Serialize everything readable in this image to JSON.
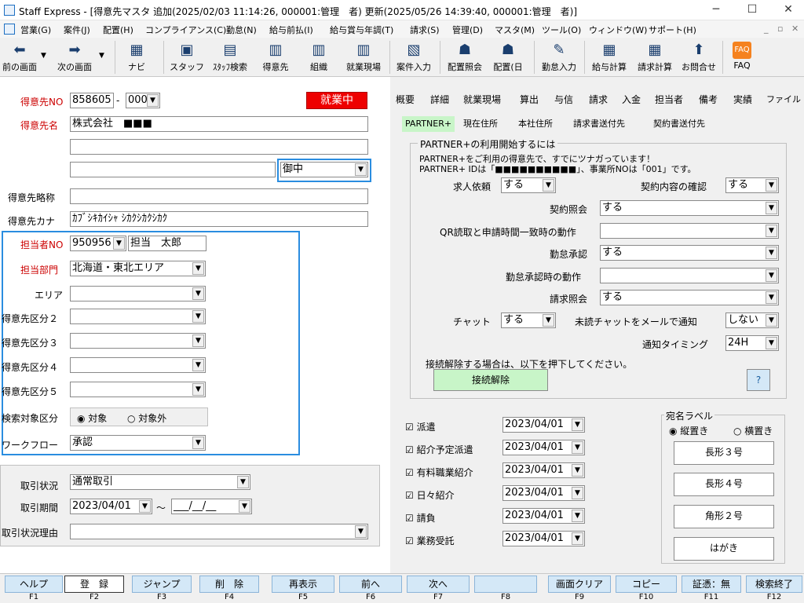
{
  "window": {
    "title": "Staff Express - [得意先マスタ 追加(2025/02/03 11:14:26, 000001:管理　者) 更新(2025/05/26 14:39:40, 000001:管理　者)]"
  },
  "menu": [
    "営業(G)",
    "案件(J)",
    "配置(H)",
    "コンプライアンス(C)",
    "勤怠(N)",
    "給与前払(I)",
    "給与賞与年調(T)",
    "請求(S)",
    "管理(D)",
    "マスタ(M)",
    "ツール(O)",
    "ウィンドウ(W)",
    "サポート(H)"
  ],
  "toolbar": [
    "前の画面",
    "次の画面",
    "ナビ",
    "スタッフ",
    "ｽﾀｯﾌ検索",
    "得意先",
    "組織",
    "就業現場",
    "案件入力",
    "配置照会",
    "配置(日",
    "勤怠入力",
    "給与計算",
    "請求計算",
    "お問合せ",
    "FAQ"
  ],
  "left": {
    "customer_no_label": "得意先NO",
    "customer_no": "858605",
    "customer_no_sep": "-",
    "customer_no_sub": "000",
    "status_badge": "就業中",
    "name_label": "得意先名",
    "name_value": "株式会社　■■■",
    "honorific": "御中",
    "short_label": "得意先略称",
    "kana_label": "得意先カナ",
    "kana_value": "ｶﾌﾞｼｷｶｲｼｬ ｼｶｸｼｶｸｼｶｸ",
    "staff_no_label": "担当者NO",
    "staff_no": "950956",
    "staff_name": "担当　太郎",
    "dept_label": "担当部門",
    "dept_value": "北海道・東北エリア",
    "area_label": "エリア",
    "cat2": "得意先区分２",
    "cat3": "得意先区分３",
    "cat4": "得意先区分４",
    "cat5": "得意先区分５",
    "search_label": "検索対象区分",
    "search_on": "対象",
    "search_off": "対象外",
    "workflow_label": "ワークフロー",
    "workflow_value": "承認",
    "trade_status_label": "取引状況",
    "trade_status_value": "通常取引",
    "trade_period_label": "取引期間",
    "trade_from": "2023/04/01",
    "trade_tilde": "～",
    "trade_to": "___/__/__",
    "trade_reason_label": "取引状況理由"
  },
  "tabs": [
    "概要",
    "詳細",
    "就業現場",
    "算出",
    "与信",
    "請求",
    "入金",
    "担当者",
    "備考",
    "実績",
    "ファイル"
  ],
  "subtabs": [
    "PARTNER+",
    "現在住所",
    "本社住所",
    "請求書送付先",
    "契約書送付先"
  ],
  "partner": {
    "group_title": "PARTNER+の利用開始するには",
    "line1": "PARTNER+をご利用の得意先で、すでにツナガっています！",
    "line2": "PARTNER+ IDは「■■■■■■■■■■」、事業所NOは「001」です。",
    "req_label": "求人依頼",
    "req_value": "する",
    "confirm_label": "契約内容の確認",
    "confirm_value": "する",
    "contract_label": "契約照会",
    "contract_value": "する",
    "qr_label": "QR読取と申請時間一致時の動作",
    "att_label": "勤怠承認",
    "att_value": "する",
    "att_act_label": "勤怠承認時の動作",
    "bill_label": "請求照会",
    "bill_value": "する",
    "chat_label": "チャット",
    "chat_value": "する",
    "mail_label": "未読チャットをメールで通知",
    "mail_value": "しない",
    "timing_label": "通知タイミング",
    "timing_value": "24H",
    "disconnect_note": "接続解除する場合は、以下を押下してください。",
    "disconnect_btn": "接続解除",
    "help_btn": "?"
  },
  "contracts": [
    {
      "label": "派遣",
      "date": "2023/04/01"
    },
    {
      "label": "紹介予定派遣",
      "date": "2023/04/01"
    },
    {
      "label": "有料職業紹介",
      "date": "2023/04/01"
    },
    {
      "label": "日々紹介",
      "date": "2023/04/01"
    },
    {
      "label": "請負",
      "date": "2023/04/01"
    },
    {
      "label": "業務受託",
      "date": "2023/04/01"
    }
  ],
  "address_label": {
    "title": "宛名ラベル",
    "vertical": "縦置き",
    "horizontal": "横置き",
    "b1": "長形３号",
    "b2": "長形４号",
    "b3": "角形２号",
    "b4": "はがき"
  },
  "fkeys": [
    {
      "label": "ヘルプ",
      "num": "F1"
    },
    {
      "label": "登　録",
      "num": "F2"
    },
    {
      "label": "ジャンプ",
      "num": "F3"
    },
    {
      "label": "削　除",
      "num": "F4"
    },
    {
      "label": "再表示",
      "num": "F5"
    },
    {
      "label": "前へ",
      "num": "F6"
    },
    {
      "label": "次へ",
      "num": "F7"
    },
    {
      "label": "",
      "num": "F8"
    },
    {
      "label": "画面クリア",
      "num": "F9"
    },
    {
      "label": "コピー",
      "num": "F10"
    },
    {
      "label": "証憑：無",
      "num": "F11"
    },
    {
      "label": "検索終了",
      "num": "F12"
    }
  ]
}
